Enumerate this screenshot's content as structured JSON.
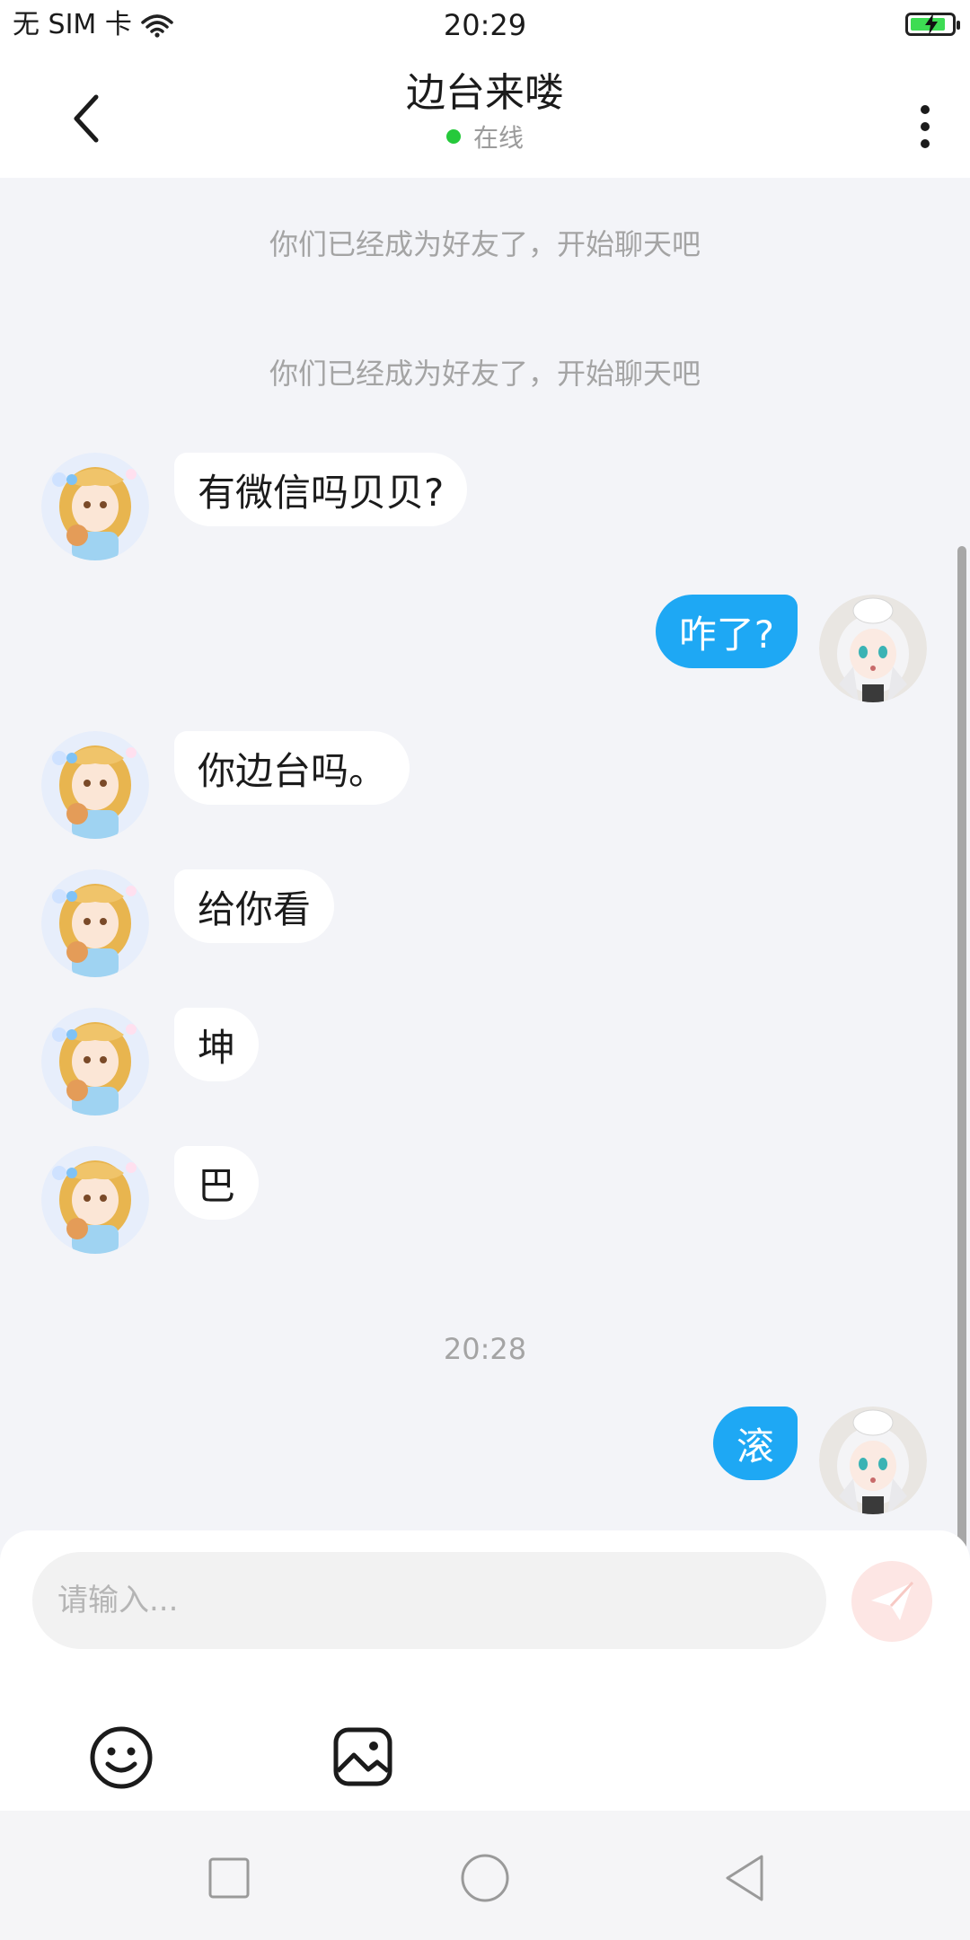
{
  "status_bar": {
    "carrier": "无 SIM 卡",
    "time": "20:29",
    "icons": [
      "wifi-icon",
      "battery-charging-icon"
    ],
    "battery_color": "#3ddc53"
  },
  "header": {
    "title": "边台来喽",
    "status": "在线",
    "status_color": "#25c93b",
    "icons": [
      "back-arrow-icon",
      "more-vertical-icon"
    ]
  },
  "chat": {
    "system_messages": [
      "你们已经成为好友了，开始聊天吧",
      "你们已经成为好友了，开始聊天吧"
    ],
    "messages": [
      {
        "side": "left",
        "text": "有微信吗贝贝?"
      },
      {
        "side": "right",
        "text": "咋了?"
      },
      {
        "side": "left",
        "text": "你边台吗。"
      },
      {
        "side": "left",
        "text": "给你看"
      },
      {
        "side": "left",
        "text": "坤"
      },
      {
        "side": "left",
        "text": "巴"
      },
      {
        "side": "right",
        "text": "滚"
      }
    ],
    "timestamp": "20:28",
    "bubble_colors": {
      "left": "#ffffff",
      "right": "#1ea8f4"
    }
  },
  "input": {
    "placeholder": "请输入...",
    "value": "",
    "icons": [
      "send-icon",
      "emoji-icon",
      "image-icon"
    ]
  },
  "nav_bar": {
    "icons": [
      "recent-apps-icon",
      "home-icon",
      "back-icon"
    ]
  }
}
